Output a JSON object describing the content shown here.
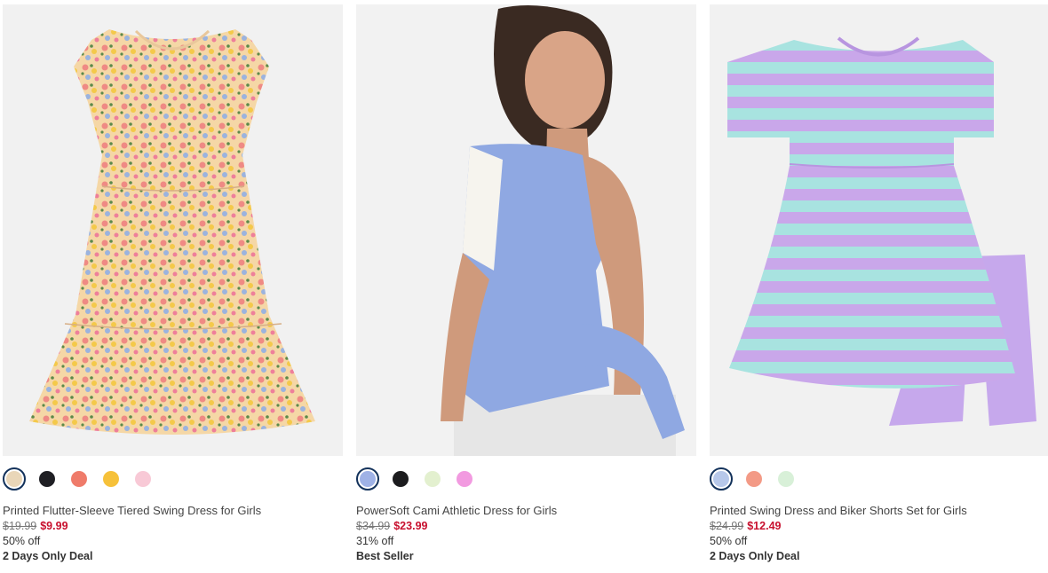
{
  "products": [
    {
      "title": "Printed Flutter-Sleeve Tiered Swing Dress for Girls",
      "image_alt": "Floral dress",
      "original_price": "$19.99",
      "sale_price": "$9.99",
      "discount": "50% off",
      "badge": "2 Days Only Deal",
      "swatches": [
        {
          "color": "#e9d6b8",
          "selected": true
        },
        {
          "color": "#1f1f24",
          "selected": false
        },
        {
          "color": "#ef7b6a",
          "selected": false
        },
        {
          "color": "#f6c13a",
          "selected": false
        },
        {
          "color": "#f8c9d6",
          "selected": false
        }
      ]
    },
    {
      "title": "PowerSoft Cami Athletic Dress for Girls",
      "image_alt": "Girl in athletic dress",
      "original_price": "$34.99",
      "sale_price": "$23.99",
      "discount": "31% off",
      "badge": "Best Seller",
      "swatches": [
        {
          "color": "#9fb2e6",
          "selected": true
        },
        {
          "color": "#1c1c1e",
          "selected": false
        },
        {
          "color": "#e3f0cf",
          "selected": false
        },
        {
          "color": "#f29ae0",
          "selected": false
        }
      ]
    },
    {
      "title": "Printed Swing Dress and Biker Shorts Set for Girls",
      "image_alt": "Striped dress with biker shorts",
      "original_price": "$24.99",
      "sale_price": "$12.49",
      "discount": "50% off",
      "badge": "2 Days Only Deal",
      "swatches": [
        {
          "color": "#b7c8ea",
          "selected": true
        },
        {
          "color": "#f39a86",
          "selected": false
        },
        {
          "color": "#d8f0d8",
          "selected": false
        }
      ]
    }
  ]
}
